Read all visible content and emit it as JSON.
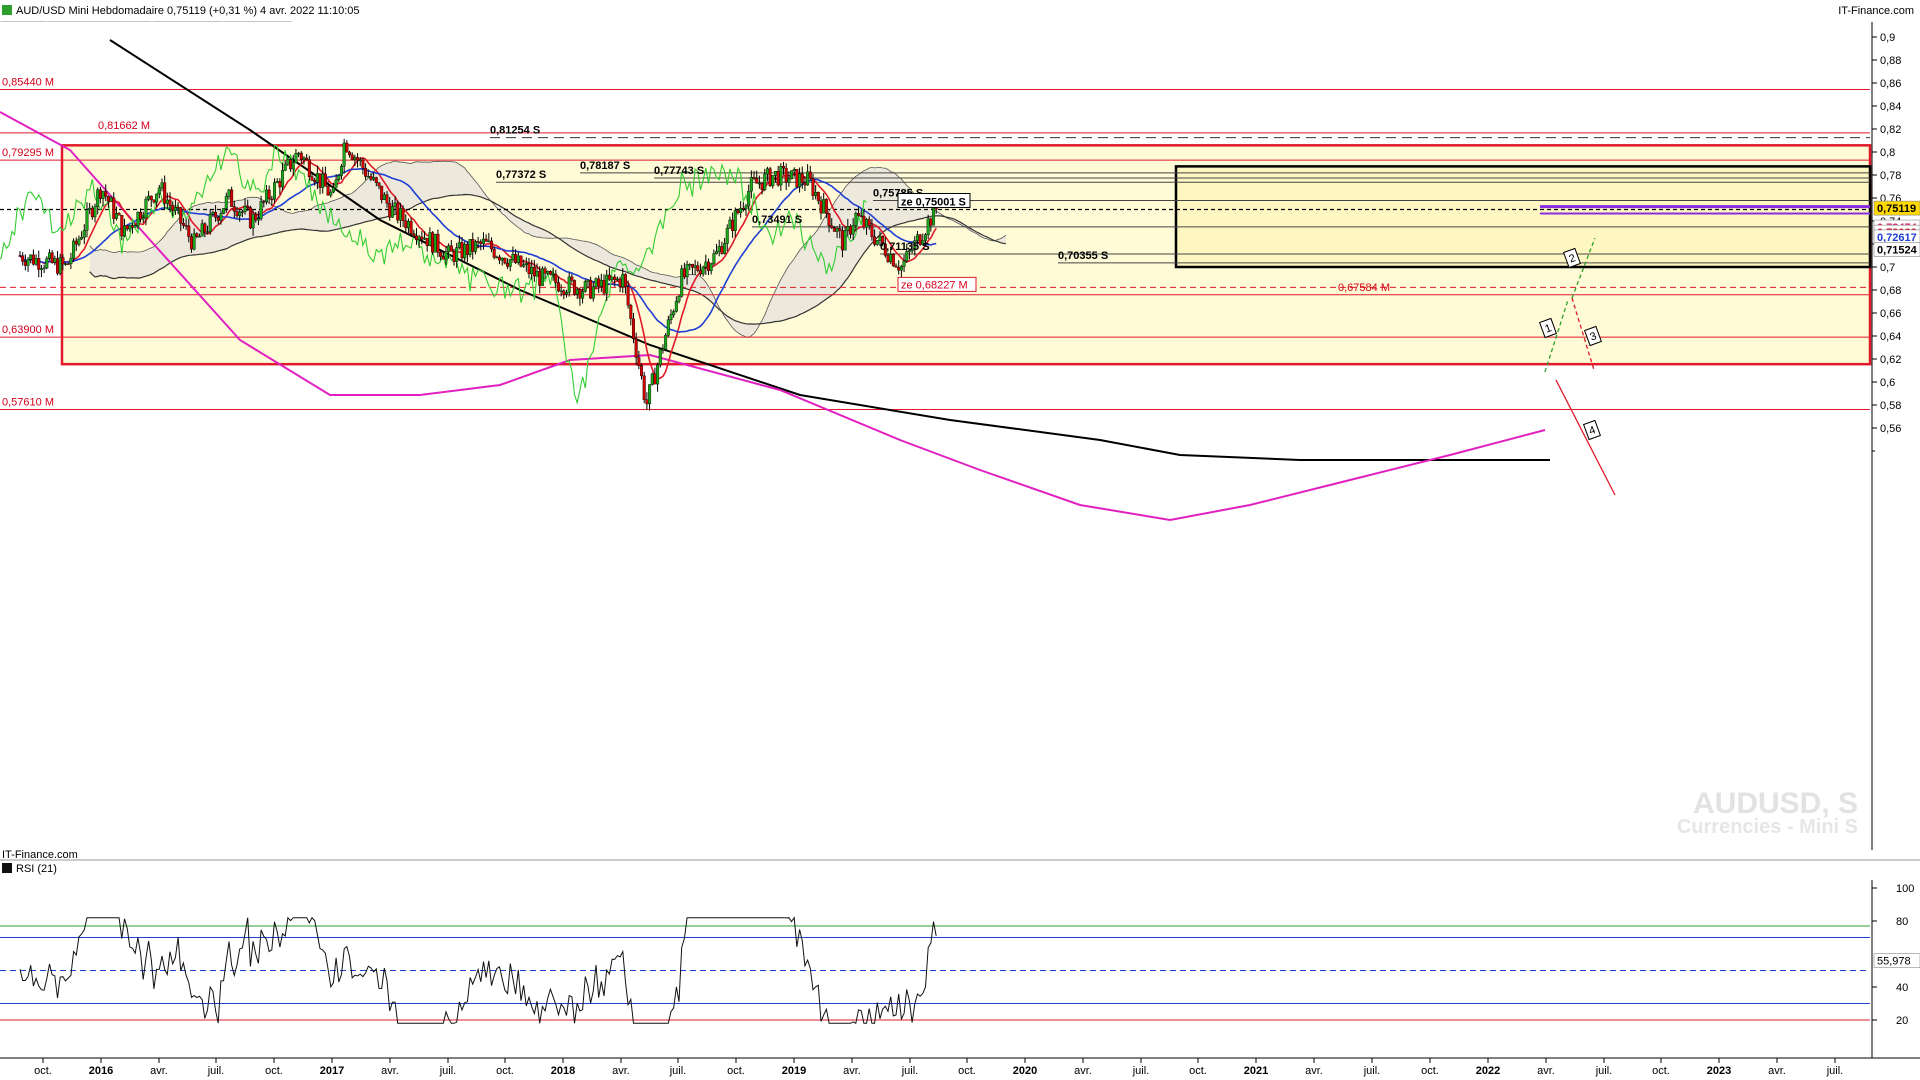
{
  "header": {
    "title": "AUD/USD Mini Hebdomadaire 0,75119 (+0,31 %) 4 avr. 2022 11:10:05",
    "source": "IT-Finance.com",
    "source_bottom": "IT-Finance.com",
    "legend": [
      {
        "label": "Prix",
        "color": "#2ca02c"
      },
      {
        "label": "Ichimoku (9 26 52)",
        "color": "#8c2d3c"
      },
      {
        "label": "SMA (200)",
        "color": "#000000"
      },
      {
        "label": "SMA (100)",
        "color": "#e020c0"
      }
    ]
  },
  "watermark": {
    "line1": "AUDUSD, S",
    "line2": "Currencies - Mini S"
  },
  "rsi_panel": {
    "label": "RSI (21)",
    "current": "55,978",
    "ticks": [
      "100",
      "80",
      "40",
      "20"
    ]
  },
  "chart_data": {
    "type": "candlestick",
    "title": "AUD/USD Mini Hebdomadaire",
    "x_ticks": [
      "oct.",
      "2016",
      "avr.",
      "juil.",
      "oct.",
      "2017",
      "avr.",
      "juil.",
      "oct.",
      "2018",
      "avr.",
      "juil.",
      "oct.",
      "2019",
      "avr.",
      "juil.",
      "oct.",
      "2020",
      "avr.",
      "juil.",
      "oct.",
      "2021",
      "avr.",
      "juil.",
      "oct.",
      "2022",
      "avr.",
      "juil.",
      "oct.",
      "2023",
      "avr.",
      "juil."
    ],
    "y_ticks": [
      "0,9",
      "0,88",
      "0,86",
      "0,84",
      "0,82",
      "0,8",
      "0,78",
      "0,76",
      "0,74",
      "0,72",
      "0,7",
      "0,68",
      "0,66",
      "0,64",
      "0,62",
      "0,6",
      "0,58",
      "0,56"
    ],
    "ylim": [
      0.545,
      0.905
    ],
    "current_price": 0.75119,
    "price_tags": [
      {
        "label": "0,75119",
        "value": 0.75119,
        "color": "#ffd800",
        "text_color": "#000000"
      },
      {
        "label": "0,73474",
        "value": 0.73474,
        "color": "#ffffff",
        "text_color": "#d81b60"
      },
      {
        "label": "0,73028",
        "value": 0.73028,
        "color": "#ffffff",
        "text_color": "#d4001a"
      },
      {
        "label": "0,72617",
        "value": 0.72617,
        "color": "#ffffff",
        "text_color": "#1f3fd4"
      },
      {
        "label": "0,71524",
        "value": 0.71524,
        "color": "#ffffff",
        "text_color": "#000000"
      }
    ],
    "levels": [
      {
        "label": "0,85440 M",
        "value": 0.8544,
        "kind": "M"
      },
      {
        "label": "0,81662 M",
        "value": 0.81662,
        "kind": "M"
      },
      {
        "label": "0,79295 M",
        "value": 0.79295,
        "kind": "M"
      },
      {
        "label": "0,67584 M",
        "value": 0.67584,
        "kind": "M"
      },
      {
        "label": "0,63900 M",
        "value": 0.639,
        "kind": "M"
      },
      {
        "label": "0,57610 M",
        "value": 0.5761,
        "kind": "M"
      },
      {
        "label": "0,81254 S",
        "value": 0.81254,
        "kind": "S"
      },
      {
        "label": "0,78187 S",
        "value": 0.78187,
        "kind": "S"
      },
      {
        "label": "0,77743 S",
        "value": 0.77743,
        "kind": "S"
      },
      {
        "label": "0,77372 S",
        "value": 0.77372,
        "kind": "S"
      },
      {
        "label": "0,75785 S",
        "value": 0.75785,
        "kind": "S"
      },
      {
        "label": "ze 0,75001 S",
        "value": 0.75001,
        "kind": "S"
      },
      {
        "label": "0,73491 S",
        "value": 0.73491,
        "kind": "S"
      },
      {
        "label": "0,71135 S",
        "value": 0.71135,
        "kind": "S"
      },
      {
        "label": "0,70355 S",
        "value": 0.70355,
        "kind": "S"
      },
      {
        "label": "ze 0,68227 M",
        "value": 0.68227,
        "kind": "M"
      }
    ],
    "zones": [
      {
        "y_top": 0.8058,
        "y_bottom": 0.6155,
        "x_start": "2015-10",
        "x_end": "2023-10"
      },
      {
        "y_top": 0.7875,
        "y_bottom": 0.7,
        "x_start": "2020-08",
        "x_end": "2023-10"
      }
    ],
    "scenario_labels": [
      "1",
      "2",
      "3",
      "4"
    ],
    "key_prices": [
      {
        "date": "2015-09",
        "close": 0.71
      },
      {
        "date": "2016-01",
        "close": 0.7
      },
      {
        "date": "2016-04",
        "close": 0.77
      },
      {
        "date": "2016-06",
        "close": 0.73
      },
      {
        "date": "2016-09",
        "close": 0.77
      },
      {
        "date": "2016-12",
        "close": 0.72
      },
      {
        "date": "2017-03",
        "close": 0.76
      },
      {
        "date": "2017-05",
        "close": 0.74
      },
      {
        "date": "2017-09",
        "close": 0.8
      },
      {
        "date": "2017-12",
        "close": 0.76
      },
      {
        "date": "2018-01",
        "close": 0.81
      },
      {
        "date": "2018-05",
        "close": 0.75
      },
      {
        "date": "2018-10",
        "close": 0.71
      },
      {
        "date": "2019-01",
        "close": 0.72
      },
      {
        "date": "2019-06",
        "close": 0.69
      },
      {
        "date": "2019-10",
        "close": 0.68
      },
      {
        "date": "2020-01",
        "close": 0.69
      },
      {
        "date": "2020-03",
        "close": 0.58
      },
      {
        "date": "2020-06",
        "close": 0.69
      },
      {
        "date": "2020-09",
        "close": 0.71
      },
      {
        "date": "2020-12",
        "close": 0.77
      },
      {
        "date": "2021-02",
        "close": 0.78
      },
      {
        "date": "2021-05",
        "close": 0.775
      },
      {
        "date": "2021-08",
        "close": 0.72
      },
      {
        "date": "2021-09",
        "close": 0.745
      },
      {
        "date": "2022-01",
        "close": 0.7
      },
      {
        "date": "2022-04",
        "close": 0.751
      }
    ]
  }
}
